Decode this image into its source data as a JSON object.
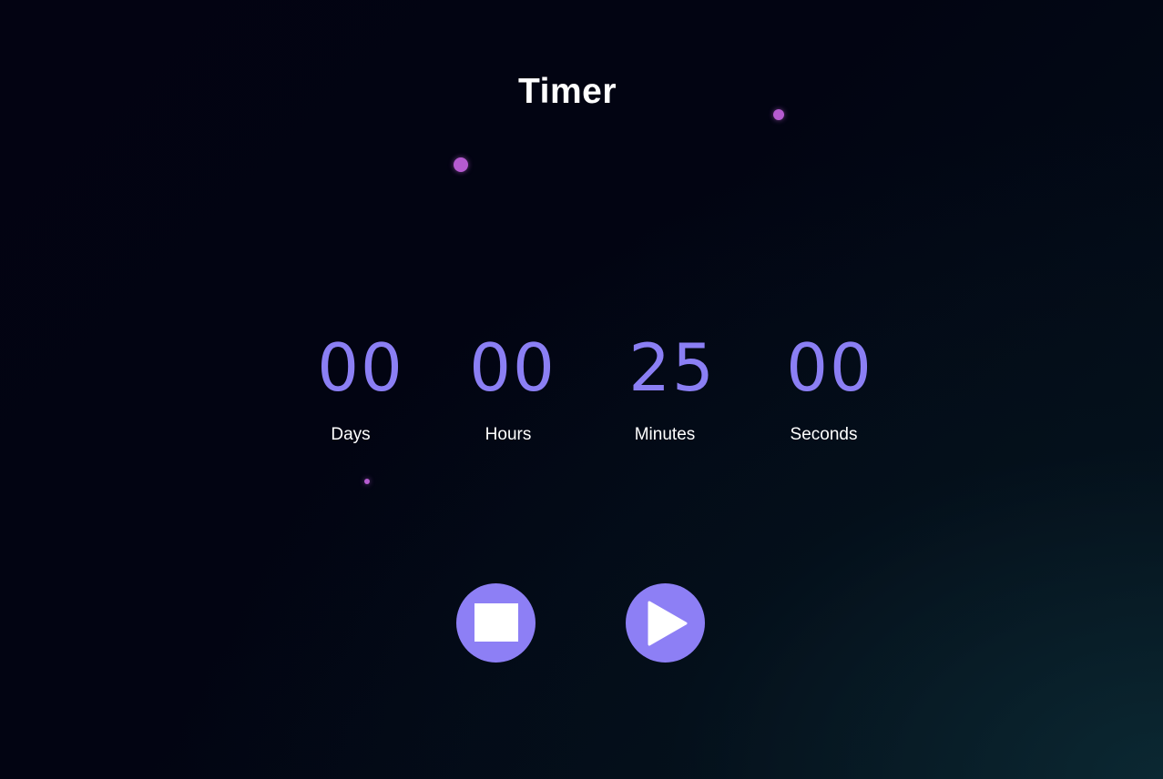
{
  "header": {
    "title": "Timer"
  },
  "timer": {
    "units": [
      {
        "key": "days",
        "value": "00",
        "label": "Days"
      },
      {
        "key": "hours",
        "value": "00",
        "label": "Hours"
      },
      {
        "key": "minutes",
        "value": "25",
        "label": "Minutes"
      },
      {
        "key": "seconds",
        "value": "00",
        "label": "Seconds"
      }
    ]
  },
  "controls": {
    "stop_icon": "stop-icon",
    "play_icon": "play-icon"
  },
  "colors": {
    "accent": "#8b7ff4",
    "particle": "#b55bd0",
    "background": "#030312"
  }
}
